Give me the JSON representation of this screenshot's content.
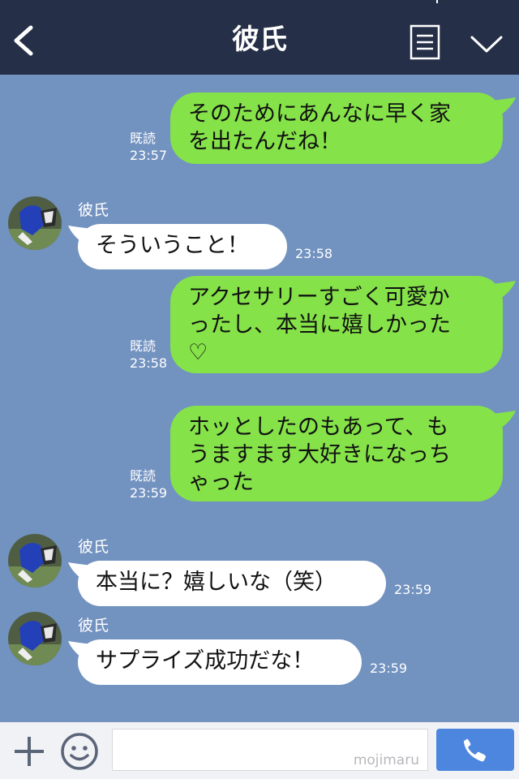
{
  "header": {
    "title": "彼氏",
    "back_icon": "chevron-left-icon",
    "menu_icon": "list-menu-icon",
    "expand_icon": "chevron-down-icon"
  },
  "colors": {
    "header_bg": "#253048",
    "chat_bg": "#7292c0",
    "sent_bubble": "#85e249",
    "received_bubble": "#ffffff",
    "send_button": "#4c86df"
  },
  "messages": [
    {
      "direction": "sent",
      "text_lines": [
        "そのためにあんなに早く家",
        "を出たんだね！"
      ],
      "read": "既読",
      "time": "23:57"
    },
    {
      "direction": "received",
      "sender": "彼氏",
      "text": "そういうこと！",
      "time": "23:58"
    },
    {
      "direction": "sent",
      "text_lines": [
        "アクセサリーすごく可愛か",
        "ったし、本当に嬉しかった",
        "♡"
      ],
      "read": "既読",
      "time": "23:58"
    },
    {
      "direction": "sent",
      "text_lines": [
        "ホッとしたのもあって、も",
        "うますます大好きになっち",
        "ゃった"
      ],
      "read": "既読",
      "time": "23:59"
    },
    {
      "direction": "received",
      "sender": "彼氏",
      "text": "本当に？嬉しいな（笑）",
      "time": "23:59"
    },
    {
      "direction": "received",
      "sender": "彼氏",
      "text": "サプライズ成功だな！",
      "time": "23:59"
    }
  ],
  "input_bar": {
    "plus_icon": "plus-icon",
    "emoji_icon": "smiley-icon",
    "input_value": "",
    "watermark": "mojimaru",
    "call_icon": "phone-icon"
  }
}
